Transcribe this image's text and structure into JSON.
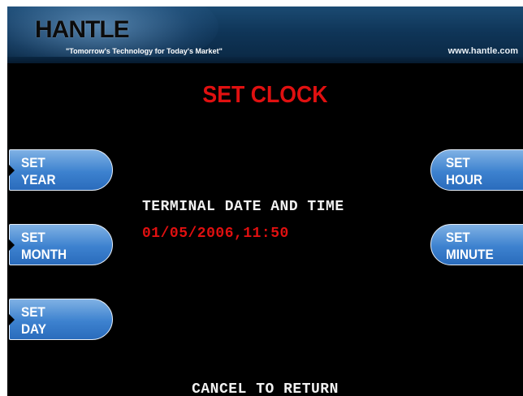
{
  "header": {
    "logo_text": "HANTLE",
    "tagline": "\"Tomorrow's Technology for Today's Market\"",
    "website": "www.hantle.com"
  },
  "screen": {
    "title": "SET CLOCK",
    "info_heading": "TERMINAL DATE AND TIME",
    "datetime_value": "01/05/2006,11:50",
    "footer_message": "CANCEL TO RETURN"
  },
  "left_buttons": [
    {
      "line1": "SET",
      "line2": "YEAR"
    },
    {
      "line1": "SET",
      "line2": "MONTH"
    },
    {
      "line1": "SET",
      "line2": "DAY"
    }
  ],
  "right_buttons": [
    {
      "line1": "SET",
      "line2": "HOUR"
    },
    {
      "line1": "SET",
      "line2": "MINUTE"
    }
  ],
  "colors": {
    "title_red": "#e01010",
    "button_blue": "#3d82cf",
    "background": "#000000",
    "banner_blue": "#0f3558"
  }
}
